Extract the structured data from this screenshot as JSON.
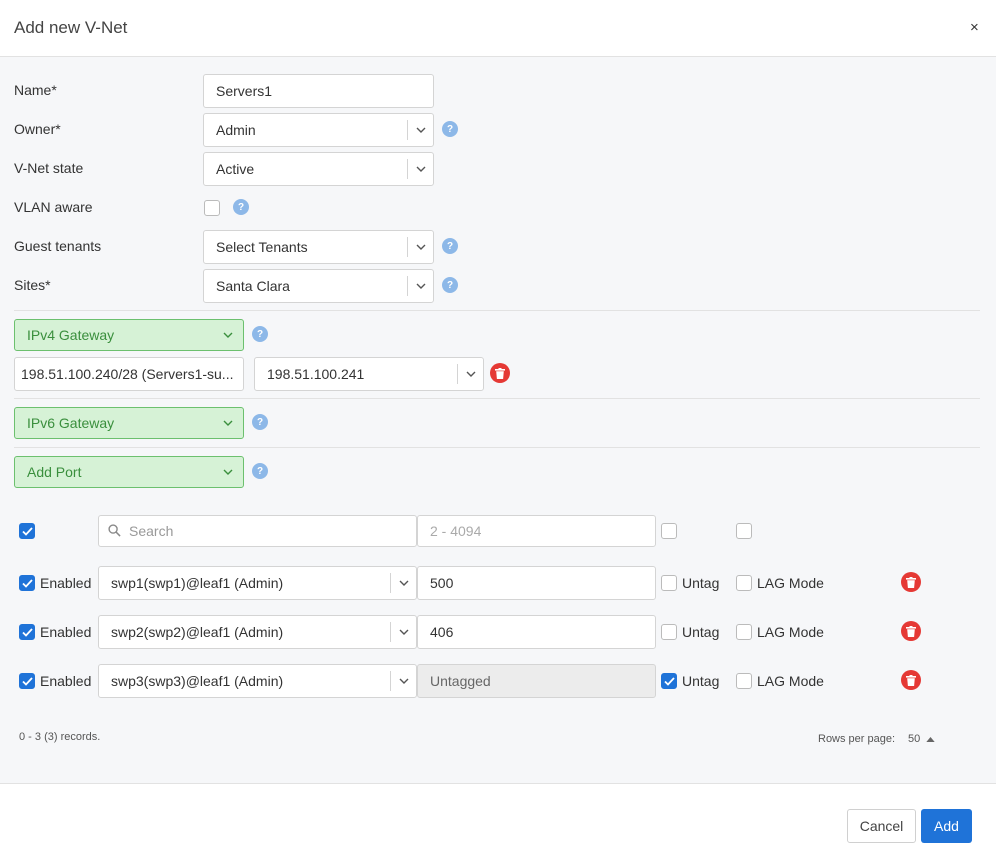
{
  "dialog": {
    "title": "Add new V-Net",
    "close_symbol": "×"
  },
  "form": {
    "name_label": "Name*",
    "name_value": "Servers1",
    "owner_label": "Owner*",
    "owner_value": "Admin",
    "state_label": "V-Net state",
    "state_value": "Active",
    "vlan_label": "VLAN aware",
    "vlan_checked": false,
    "guest_label": "Guest tenants",
    "guest_placeholder": "Select Tenants",
    "sites_label": "Sites*",
    "sites_value": "Santa Clara",
    "help_symbol": "?"
  },
  "ipv4": {
    "label": "IPv4 Gateway",
    "subnet_value": "198.51.100.240/28 (Servers1-su...",
    "ip_value": "198.51.100.241"
  },
  "ipv6": {
    "label": "IPv6 Gateway"
  },
  "add_port": {
    "label": "Add Port"
  },
  "ports": {
    "search_placeholder": "Search",
    "vlan_range_placeholder": "2 - 4094",
    "enabled_label": "Enabled",
    "untag_label": "Untag",
    "lag_label": "LAG Mode",
    "rows": [
      {
        "port": "swp1(swp1)@leaf1 (Admin)",
        "vlan": "500",
        "untag": false,
        "lag": false
      },
      {
        "port": "swp2(swp2)@leaf1 (Admin)",
        "vlan": "406",
        "untag": false,
        "lag": false
      },
      {
        "port": "swp3(swp3)@leaf1 (Admin)",
        "vlan": "Untagged",
        "untag": true,
        "lag": false
      }
    ],
    "records_text": "0 - 3 (3) records.",
    "rows_per_page_label": "Rows per page:",
    "rows_per_page_value": "50"
  },
  "footer": {
    "cancel_label": "Cancel",
    "add_label": "Add"
  },
  "colors": {
    "accent": "#1f73d8",
    "green_fill": "#d6f2d6",
    "green_border": "#6cc06e",
    "danger": "#e53935",
    "help": "#8db8e8"
  }
}
